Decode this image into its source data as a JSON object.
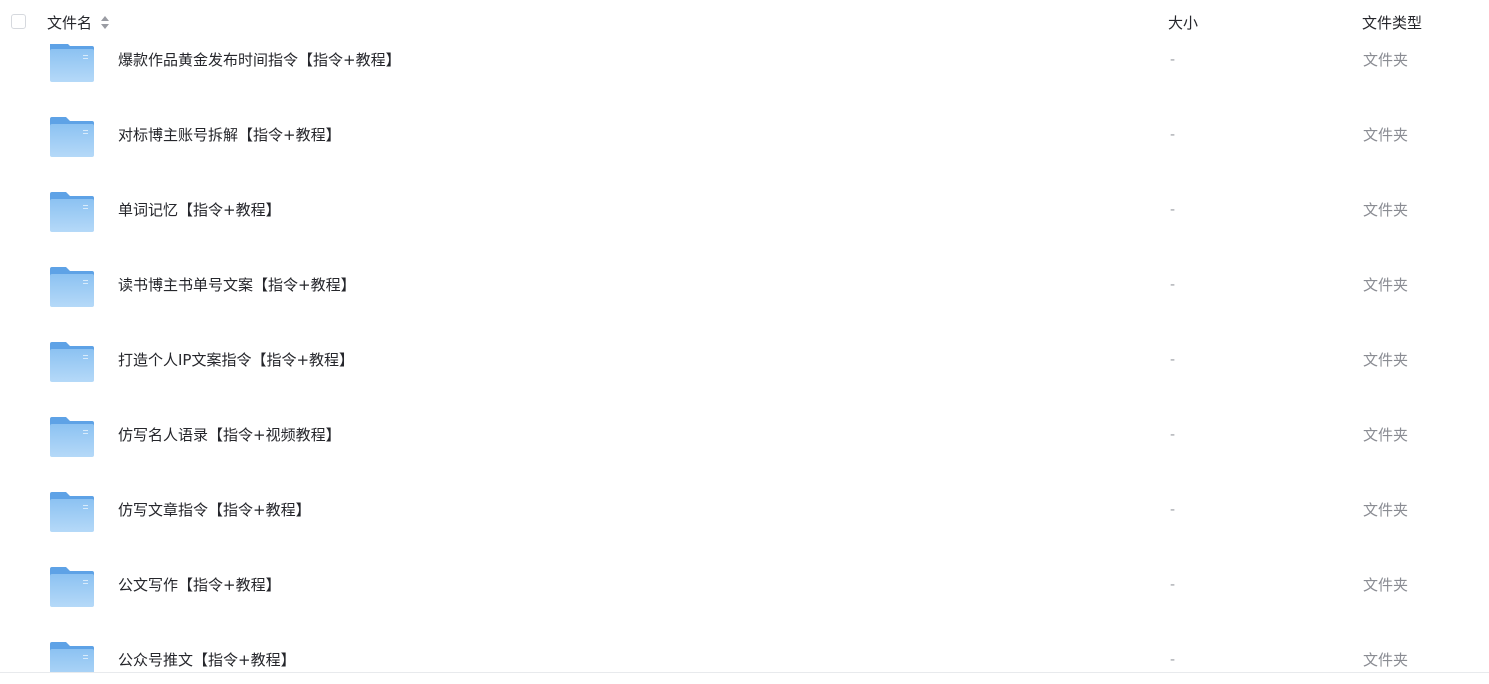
{
  "header": {
    "name_label": "文件名",
    "size_label": "大小",
    "type_label": "文件类型"
  },
  "icons": {
    "folder": "folder-icon",
    "sort": "sort-icon"
  },
  "colors": {
    "folder_top": "#5ea2e6",
    "folder_body": "#8dc3f2",
    "text": "#25262b",
    "muted": "#8a8c93"
  },
  "rows": [
    {
      "name": "爆款作品黄金发布时间指令【指令+教程】",
      "size": "-",
      "type": "文件夹"
    },
    {
      "name": "对标博主账号拆解【指令+教程】",
      "size": "-",
      "type": "文件夹"
    },
    {
      "name": "单词记忆【指令+教程】",
      "size": "-",
      "type": "文件夹"
    },
    {
      "name": "读书博主书单号文案【指令+教程】",
      "size": "-",
      "type": "文件夹"
    },
    {
      "name": "打造个人IP文案指令【指令+教程】",
      "size": "-",
      "type": "文件夹"
    },
    {
      "name": "仿写名人语录【指令+视频教程】",
      "size": "-",
      "type": "文件夹"
    },
    {
      "name": "仿写文章指令【指令+教程】",
      "size": "-",
      "type": "文件夹"
    },
    {
      "name": "公文写作【指令+教程】",
      "size": "-",
      "type": "文件夹"
    },
    {
      "name": "公众号推文【指令+教程】",
      "size": "-",
      "type": "文件夹"
    }
  ]
}
